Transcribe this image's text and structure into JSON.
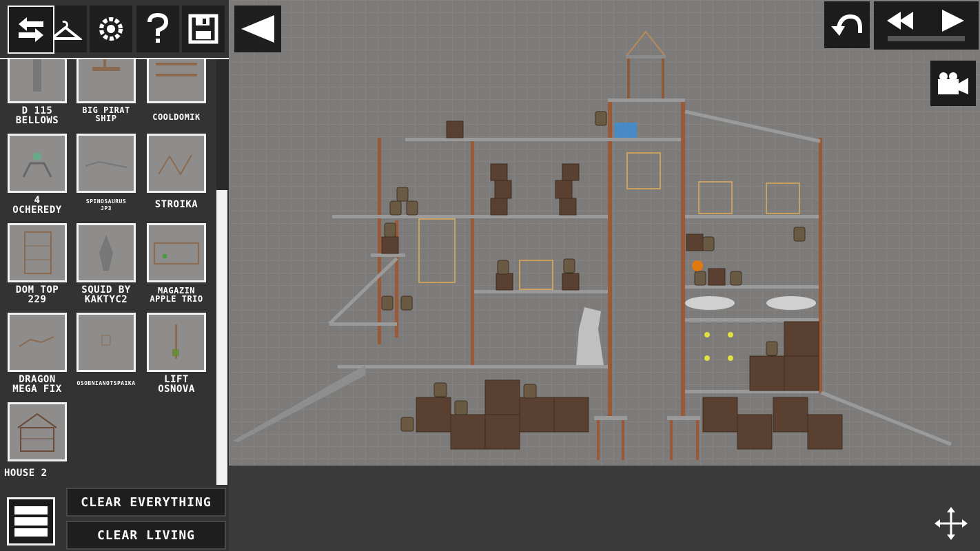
{
  "toolbar": {
    "icons": [
      "swap-arrows-icon",
      "hanger-icon",
      "gear-icon",
      "help-icon",
      "save-icon"
    ],
    "collapse_icon": "triangle-left-icon"
  },
  "saves": [
    {
      "label": "D 115\nBELLOWS"
    },
    {
      "label": "BIG PIRAT\nSHIP"
    },
    {
      "label": "COOLDOMIK"
    },
    {
      "label": "4\nOCHEREDY"
    },
    {
      "label": "SPINOSAURUS\nJP3"
    },
    {
      "label": "STROIKA"
    },
    {
      "label": "DOM TOP\n229"
    },
    {
      "label": "SQUID BY\nKAKTYC2"
    },
    {
      "label": "MAGAZIN\nAPPLE TRIO"
    },
    {
      "label": "DRAGON\nMEGA FIX"
    },
    {
      "label": "OSOBNIANOTSPAIKA"
    },
    {
      "label": "LIFT\nOSNOVA"
    },
    {
      "label": "HOUSE 2"
    }
  ],
  "bottom": {
    "clear_everything": "CLEAR EVERYTHING",
    "clear_living": "CLEAR LIVING"
  },
  "controls": {
    "undo_icon": "undo-icon",
    "rewind_icon": "rewind-icon",
    "play_icon": "play-icon",
    "camera_icon": "camera-icon",
    "move_icon": "move-arrows-icon"
  },
  "colors": {
    "background": "#7d7b79",
    "panel": "#333333",
    "accent": "#f2f2f2"
  }
}
